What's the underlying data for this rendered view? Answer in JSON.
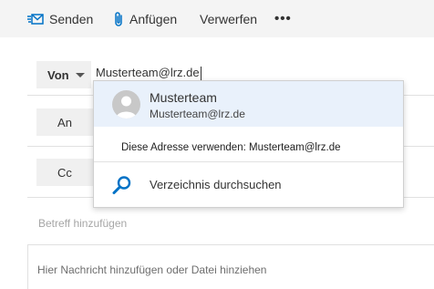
{
  "toolbar": {
    "send_label": "Senden",
    "attach_label": "Anfügen",
    "discard_label": "Verwerfen",
    "more_label": "•••"
  },
  "icons": {
    "send": "send-icon",
    "attach": "paperclip-icon",
    "avatar": "person-avatar-icon",
    "search": "search-icon",
    "caret": "chevron-down-icon"
  },
  "compose": {
    "from_label": "Von",
    "from_value": "Musterteam@lrz.de",
    "to_label": "An",
    "cc_label": "Cc",
    "subject_placeholder": "Betreff hinzufügen",
    "body_placeholder": "Hier Nachricht hinzufügen oder Datei hinziehen"
  },
  "suggestions": {
    "contact_name": "Musterteam",
    "contact_email": "Musterteam@lrz.de",
    "use_address": "Diese Adresse verwenden: Musterteam@lrz.de",
    "search_directory": "Verzeichnis durchsuchen"
  },
  "colors": {
    "accent": "#0072c6",
    "toolbar_bg": "#f4f4f4",
    "selected_bg": "#e9f1fb",
    "field_btn_bg": "#f0f0f0"
  }
}
